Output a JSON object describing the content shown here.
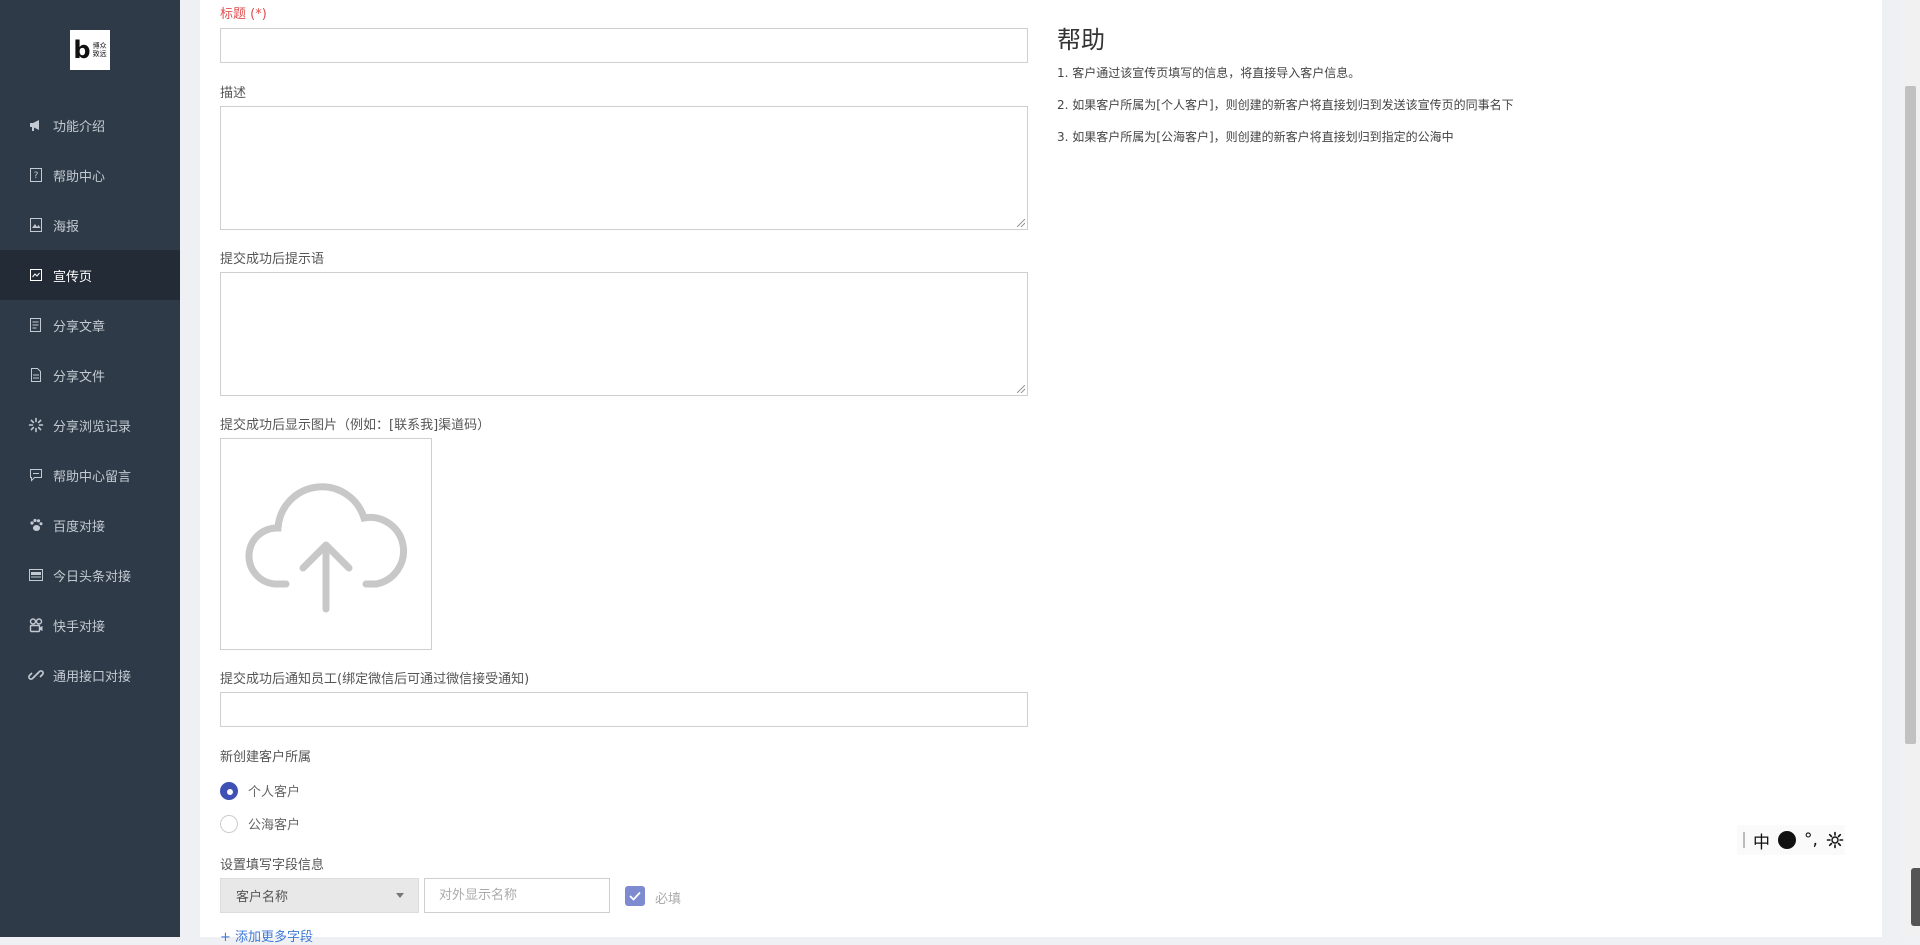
{
  "logo": {
    "line1": "博众",
    "line2": "致远"
  },
  "sidebar": {
    "items": [
      {
        "label": "功能介绍",
        "icon": "megaphone-icon",
        "active": false
      },
      {
        "label": "帮助中心",
        "icon": "help-book-icon",
        "active": false
      },
      {
        "label": "海报",
        "icon": "poster-icon",
        "active": false
      },
      {
        "label": "宣传页",
        "icon": "promo-page-icon",
        "active": true
      },
      {
        "label": "分享文章",
        "icon": "article-icon",
        "active": false
      },
      {
        "label": "分享文件",
        "icon": "file-icon",
        "active": false
      },
      {
        "label": "分享浏览记录",
        "icon": "loading-icon",
        "active": false
      },
      {
        "label": "帮助中心留言",
        "icon": "message-icon",
        "active": false
      },
      {
        "label": "百度对接",
        "icon": "paw-icon",
        "active": false
      },
      {
        "label": "今日头条对接",
        "icon": "toutiao-icon",
        "active": false
      },
      {
        "label": "快手对接",
        "icon": "kuaishou-icon",
        "active": false
      },
      {
        "label": "通用接口对接",
        "icon": "link-icon",
        "active": false
      }
    ]
  },
  "form": {
    "title_label": "标题 (*)",
    "title_value": "",
    "description_label": "描述",
    "success_message_label": "提交成功后提示语",
    "success_image_label": "提交成功后显示图片（例如：[联系我]渠道码）",
    "notify_label": "提交成功后通知员工(绑定微信后可通过微信接受通知)",
    "owner_label": "新创建客户所属",
    "owner_options": [
      {
        "label": "个人客户",
        "selected": true
      },
      {
        "label": "公海客户",
        "selected": false
      }
    ],
    "fields_label": "设置填写字段信息",
    "field_select_value": "客户名称",
    "display_name_placeholder": "对外显示名称",
    "required_label": "必填",
    "required_checked": true,
    "add_more_label": "+ 添加更多字段"
  },
  "help": {
    "title": "帮助",
    "lines": [
      "1. 客户通过该宣传页填写的信息，将直接导入客户信息。",
      "2. 如果客户所属为[个人客户]，则创建的新客户将直接划归到发送该宣传页的同事名下",
      "3. 如果客户所属为[公海客户]，则创建的新客户将直接划归到指定的公海中"
    ]
  },
  "ime": {
    "lang": "中",
    "punct": "°,"
  },
  "colors": {
    "sidebar_bg": "#2e3a47",
    "sidebar_active": "#232c36",
    "accent": "#3f51b5",
    "required_red": "#e04f4f"
  }
}
